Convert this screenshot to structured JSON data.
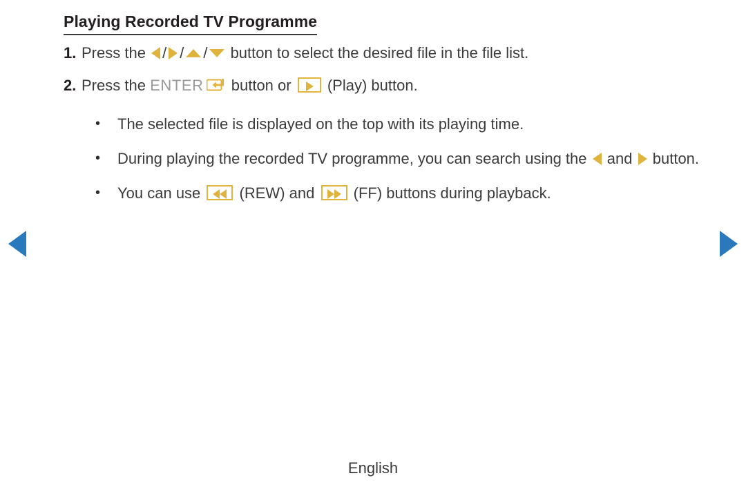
{
  "page": {
    "title": "Playing Recorded TV Programme",
    "footer_language": "English"
  },
  "colors": {
    "gold": "#E0B33C",
    "gold_border": "#E2B33E",
    "nav_blue": "#2B79BD",
    "text": "#3B3B3B",
    "heading": "#231F20",
    "enter_word_gray": "#9A9A9A"
  },
  "steps": [
    {
      "number": "1.",
      "text_before": "Press the",
      "icons": [
        "left-arrow-icon",
        "right-arrow-icon",
        "up-arrow-icon",
        "down-arrow-icon"
      ],
      "separator": "/",
      "text_after": "button to select the desired file in the file list."
    },
    {
      "number": "2.",
      "text_before": "Press the",
      "enter_label": "ENTER",
      "enter_icon": "enter-key-icon",
      "text_middle": "button or",
      "play_icon": "play-button-icon",
      "text_after": "(Play) button."
    }
  ],
  "bullets": [
    {
      "marker": "•",
      "text": "The selected file is displayed on the top with its playing time."
    },
    {
      "marker": "•",
      "text_before": "During playing the recorded TV programme, you can search using the",
      "icon_left": "left-arrow-icon",
      "text_middle": "and",
      "icon_right": "right-arrow-icon",
      "text_after": "button."
    },
    {
      "marker": "•",
      "text_before": "You can use",
      "rew_icon": "rewind-button-icon",
      "rew_label": "(REW)",
      "text_middle": "and",
      "ff_icon": "fast-forward-button-icon",
      "ff_label": "(FF)",
      "text_after": "buttons during playback."
    }
  ],
  "navigation": {
    "previous_page_icon": "nav-previous-arrow-icon",
    "next_page_icon": "nav-next-arrow-icon"
  }
}
